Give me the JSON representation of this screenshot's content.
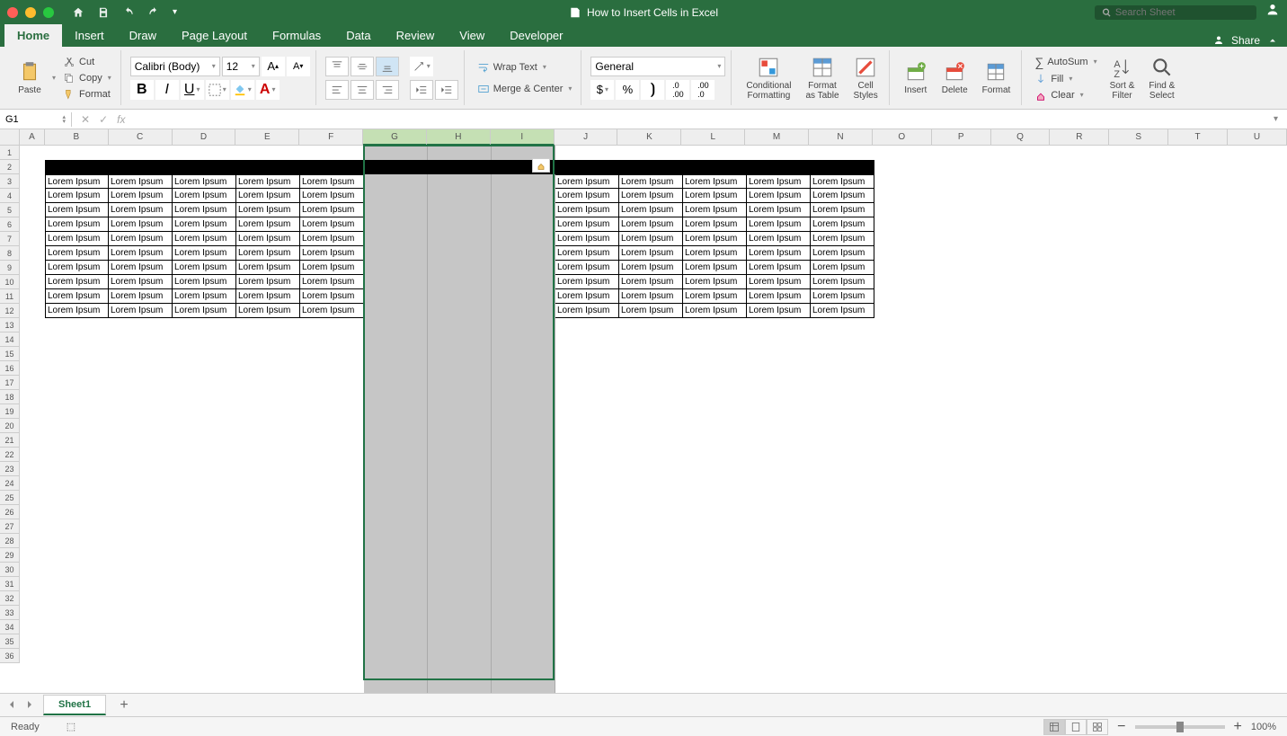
{
  "title": "How to Insert Cells in Excel",
  "search_placeholder": "Search Sheet",
  "tabs": [
    "Home",
    "Insert",
    "Draw",
    "Page Layout",
    "Formulas",
    "Data",
    "Review",
    "View",
    "Developer"
  ],
  "active_tab": "Home",
  "share_label": "Share",
  "clipboard": {
    "paste": "Paste",
    "cut": "Cut",
    "copy": "Copy",
    "format": "Format"
  },
  "font": {
    "name": "Calibri (Body)",
    "size": "12"
  },
  "alignment": {
    "wrap": "Wrap Text",
    "merge": "Merge & Center"
  },
  "number_format": "General",
  "styles": {
    "conditional": "Conditional\nFormatting",
    "table": "Format\nas Table",
    "cell": "Cell\nStyles"
  },
  "cells_group": {
    "insert": "Insert",
    "delete": "Delete",
    "format": "Format"
  },
  "editing": {
    "autosum": "AutoSum",
    "fill": "Fill",
    "clear": "Clear",
    "sort": "Sort &\nFilter",
    "find": "Find &\nSelect"
  },
  "name_box": "G1",
  "columns": [
    "A",
    "B",
    "C",
    "D",
    "E",
    "F",
    "G",
    "H",
    "I",
    "J",
    "K",
    "L",
    "M",
    "N",
    "O",
    "P",
    "Q",
    "R",
    "S",
    "T",
    "U"
  ],
  "col_widths": {
    "A": 28,
    "default": 71,
    "narrow": 66
  },
  "row_count": 36,
  "selected_cols": [
    "G",
    "H",
    "I"
  ],
  "cell_text": "Lorem Ipsum",
  "data_rows": [
    3,
    4,
    5,
    6,
    7,
    8,
    9,
    10,
    11,
    12
  ],
  "data_cols_left": [
    "B",
    "C",
    "D",
    "E",
    "F"
  ],
  "data_cols_right": [
    "J",
    "K",
    "L",
    "M",
    "N"
  ],
  "sheet_name": "Sheet1",
  "status": "Ready",
  "zoom": "100%"
}
